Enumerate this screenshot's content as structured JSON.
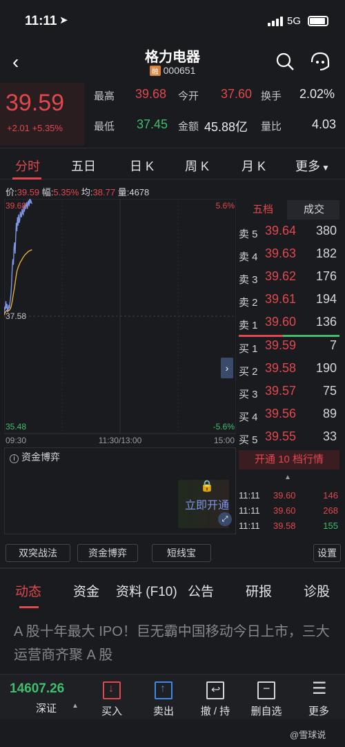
{
  "status": {
    "time": "11:11",
    "network": "5G"
  },
  "nav": {
    "title": "格力电器",
    "tag": "融",
    "code": "000651"
  },
  "quote": {
    "price": "39.59",
    "change": "+2.01 +5.35%",
    "fields": [
      {
        "label": "最高",
        "value": "39.68",
        "color": "red"
      },
      {
        "label": "今开",
        "value": "37.60",
        "color": "red"
      },
      {
        "label": "换手",
        "value": "2.02%",
        "color": "white"
      },
      {
        "label": "最低",
        "value": "37.45",
        "color": "green"
      },
      {
        "label": "金额",
        "value": "45.88亿",
        "color": "white"
      },
      {
        "label": "量比",
        "value": "4.03",
        "color": "white"
      }
    ]
  },
  "tabs": [
    "分时",
    "五日",
    "日 K",
    "周 K",
    "月 K",
    "更多"
  ],
  "info": {
    "price_label": "价:",
    "price": "39.59",
    "amp_label": "幅:",
    "amp": "5.35%",
    "avg_label": "均:",
    "avg": "38.77",
    "vol_label": "量:",
    "vol": "4678"
  },
  "chart_data": {
    "type": "line",
    "ylim": [
      35.48,
      39.68
    ],
    "ytick_labels": {
      "top": "39.68",
      "mid": "37.58",
      "bottom": "35.48"
    },
    "pct_labels": {
      "top": "5.6%",
      "bottom": "-5.6%"
    },
    "xtick_labels": [
      "09:30",
      "11:30/13:00",
      "15:00"
    ],
    "series": [
      {
        "name": "价",
        "color": "#7f96e8",
        "x": [
          0,
          1,
          2,
          3,
          4,
          5,
          6,
          7,
          8,
          9,
          10,
          11,
          12,
          13,
          14,
          15,
          16,
          17,
          18,
          19,
          20,
          21,
          22,
          23,
          24,
          25,
          26,
          27,
          28,
          29,
          30,
          31,
          32,
          33,
          34,
          35,
          36,
          37,
          38,
          39,
          40,
          41,
          42,
          43,
          44,
          45,
          46,
          47,
          48
        ],
        "values": [
          37.6,
          37.75,
          37.7,
          37.85,
          37.72,
          37.8,
          37.65,
          37.7,
          37.78,
          37.72,
          37.82,
          37.9,
          38.0,
          38.2,
          38.45,
          38.6,
          38.5,
          38.8,
          38.9,
          38.7,
          39.0,
          39.25,
          39.1,
          39.35,
          39.2,
          39.4,
          39.25,
          39.3,
          39.45,
          39.38,
          39.35,
          39.5,
          39.42,
          39.4,
          39.55,
          39.45,
          39.6,
          39.5,
          39.55,
          39.62,
          39.5,
          39.6,
          39.65,
          39.55,
          39.68,
          39.6,
          39.65,
          39.62,
          39.59
        ]
      },
      {
        "name": "均",
        "color": "#e3b23c",
        "x": [
          0,
          2,
          4,
          6,
          8,
          10,
          12,
          14,
          16,
          18,
          20,
          22,
          24,
          26,
          28,
          30,
          32,
          34,
          36,
          38,
          40,
          42,
          44,
          46,
          48
        ],
        "values": [
          37.6,
          37.65,
          37.68,
          37.67,
          37.68,
          37.7,
          37.75,
          37.85,
          37.98,
          38.1,
          38.25,
          38.38,
          38.45,
          38.5,
          38.55,
          38.58,
          38.62,
          38.65,
          38.68,
          38.7,
          38.72,
          38.74,
          38.75,
          38.76,
          38.77
        ]
      }
    ]
  },
  "orderbook": {
    "tabs": [
      "五档",
      "成交"
    ],
    "asks": [
      {
        "label": "卖 5",
        "price": "39.64",
        "vol": "380"
      },
      {
        "label": "卖 4",
        "price": "39.63",
        "vol": "182"
      },
      {
        "label": "卖 3",
        "price": "39.62",
        "vol": "176"
      },
      {
        "label": "卖 2",
        "price": "39.61",
        "vol": "194"
      },
      {
        "label": "卖 1",
        "price": "39.60",
        "vol": "136"
      }
    ],
    "bids": [
      {
        "label": "买 1",
        "price": "39.59",
        "vol": "7"
      },
      {
        "label": "买 2",
        "price": "39.58",
        "vol": "190"
      },
      {
        "label": "买 3",
        "price": "39.57",
        "vol": "75"
      },
      {
        "label": "买 4",
        "price": "39.56",
        "vol": "89"
      },
      {
        "label": "买 5",
        "price": "39.55",
        "vol": "33"
      }
    ],
    "open_btn": "开通 10 档行情",
    "ticks": [
      {
        "time": "11:11",
        "price": "39.60",
        "vol": "146",
        "vcolor": "red"
      },
      {
        "time": "11:11",
        "price": "39.60",
        "vol": "268",
        "vcolor": "red"
      },
      {
        "time": "11:11",
        "price": "39.58",
        "vol": "155",
        "vcolor": "green"
      }
    ]
  },
  "fund": {
    "label": "资金博弈",
    "open": "立即开通"
  },
  "tools": [
    "双突战法",
    "资金博弈",
    "短线宝",
    "设置"
  ],
  "dtabs": [
    "动态",
    "资金",
    "资料 (F10)",
    "公告",
    "研报",
    "诊股"
  ],
  "news": "A 股十年最大 IPO！巨无霸中国移动今日上市，三大运营商齐聚 A 股",
  "bottom": {
    "index_value": "14607.26",
    "index_name": "深证",
    "actions": [
      "买入",
      "卖出",
      "撤 / 持",
      "删自选",
      "更多"
    ]
  },
  "watermark": "@雪球说"
}
